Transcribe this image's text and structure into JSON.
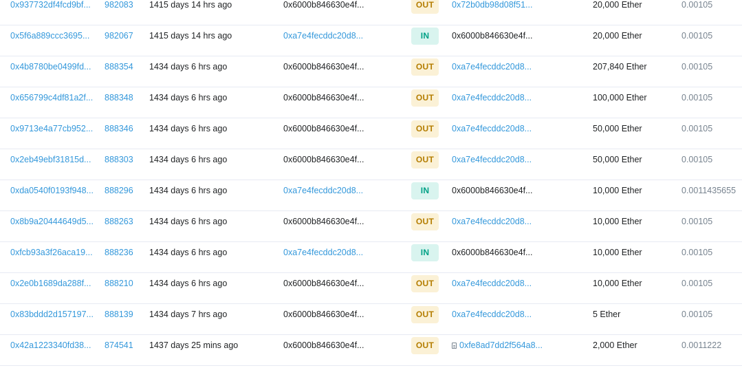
{
  "rows": [
    {
      "txn_hash": "0x937732df4fcd9bf...",
      "block": "982083",
      "age": "1415 days 14 hrs ago",
      "from": "0x6000b846630e4f...",
      "direction": "OUT",
      "to": "0x72b0db98d08f51...",
      "to_is_contract": false,
      "value": "20,000 Ether",
      "fee": "0.00105"
    },
    {
      "txn_hash": "0x5f6a889ccc3695...",
      "block": "982067",
      "age": "1415 days 14 hrs ago",
      "from": "0xa7e4fecddc20d8...",
      "direction": "IN",
      "to": "0x6000b846630e4f...",
      "to_is_contract": false,
      "value": "20,000 Ether",
      "fee": "0.00105"
    },
    {
      "txn_hash": "0x4b8780be0499fd...",
      "block": "888354",
      "age": "1434 days 6 hrs ago",
      "from": "0x6000b846630e4f...",
      "direction": "OUT",
      "to": "0xa7e4fecddc20d8...",
      "to_is_contract": false,
      "value": "207,840 Ether",
      "fee": "0.00105"
    },
    {
      "txn_hash": "0x656799c4df81a2f...",
      "block": "888348",
      "age": "1434 days 6 hrs ago",
      "from": "0x6000b846630e4f...",
      "direction": "OUT",
      "to": "0xa7e4fecddc20d8...",
      "to_is_contract": false,
      "value": "100,000 Ether",
      "fee": "0.00105"
    },
    {
      "txn_hash": "0x9713e4a77cb952...",
      "block": "888346",
      "age": "1434 days 6 hrs ago",
      "from": "0x6000b846630e4f...",
      "direction": "OUT",
      "to": "0xa7e4fecddc20d8...",
      "to_is_contract": false,
      "value": "50,000 Ether",
      "fee": "0.00105"
    },
    {
      "txn_hash": "0x2eb49ebf31815d...",
      "block": "888303",
      "age": "1434 days 6 hrs ago",
      "from": "0x6000b846630e4f...",
      "direction": "OUT",
      "to": "0xa7e4fecddc20d8...",
      "to_is_contract": false,
      "value": "50,000 Ether",
      "fee": "0.00105"
    },
    {
      "txn_hash": "0xda0540f0193f948...",
      "block": "888296",
      "age": "1434 days 6 hrs ago",
      "from": "0xa7e4fecddc20d8...",
      "direction": "IN",
      "to": "0x6000b846630e4f...",
      "to_is_contract": false,
      "value": "10,000 Ether",
      "fee": "0.0011435655"
    },
    {
      "txn_hash": "0x8b9a20444649d5...",
      "block": "888263",
      "age": "1434 days 6 hrs ago",
      "from": "0x6000b846630e4f...",
      "direction": "OUT",
      "to": "0xa7e4fecddc20d8...",
      "to_is_contract": false,
      "value": "10,000 Ether",
      "fee": "0.00105"
    },
    {
      "txn_hash": "0xfcb93a3f26aca19...",
      "block": "888236",
      "age": "1434 days 6 hrs ago",
      "from": "0xa7e4fecddc20d8...",
      "direction": "IN",
      "to": "0x6000b846630e4f...",
      "to_is_contract": false,
      "value": "10,000 Ether",
      "fee": "0.00105"
    },
    {
      "txn_hash": "0x2e0b1689da288f...",
      "block": "888210",
      "age": "1434 days 6 hrs ago",
      "from": "0x6000b846630e4f...",
      "direction": "OUT",
      "to": "0xa7e4fecddc20d8...",
      "to_is_contract": false,
      "value": "10,000 Ether",
      "fee": "0.00105"
    },
    {
      "txn_hash": "0x83bddd2d157197...",
      "block": "888139",
      "age": "1434 days 7 hrs ago",
      "from": "0x6000b846630e4f...",
      "direction": "OUT",
      "to": "0xa7e4fecddc20d8...",
      "to_is_contract": false,
      "value": "5 Ether",
      "fee": "0.00105"
    },
    {
      "txn_hash": "0x42a1223340fd38...",
      "block": "874541",
      "age": "1437 days 25 mins ago",
      "from": "0x6000b846630e4f...",
      "direction": "OUT",
      "to": "0xfe8ad7dd2f564a8...",
      "to_is_contract": true,
      "value": "2,000 Ether",
      "fee": "0.0011222"
    }
  ],
  "colors": {
    "link": "#3498db",
    "text": "#1e2022",
    "muted": "#77838f",
    "out_badge_bg": "#fbf1d6",
    "out_badge_text": "#b47d00",
    "in_badge_bg": "#d9f4ef",
    "in_badge_text": "#00a186",
    "row_border": "#e7eaf3"
  },
  "icons": {
    "contract": "contract-file-icon"
  }
}
